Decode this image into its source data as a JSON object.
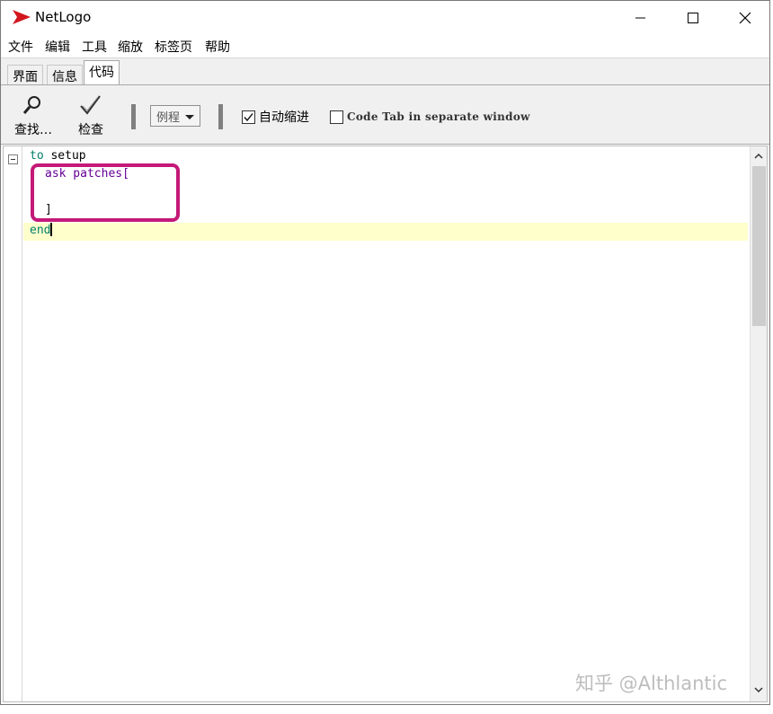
{
  "window": {
    "title": "NetLogo"
  },
  "menu": {
    "items": [
      "文件",
      "编辑",
      "工具",
      "缩放",
      "标签页",
      "帮助"
    ]
  },
  "tabs": {
    "items": [
      "界面",
      "信息",
      "代码"
    ],
    "active": "代码"
  },
  "toolbar": {
    "find_label": "查找…",
    "check_label": "检查",
    "procedures_label": "例程",
    "auto_indent_label": "自动缩进",
    "auto_indent_checked": true,
    "separate_window_label": "Code Tab in separate window",
    "separate_window_checked": false
  },
  "editor": {
    "lines": [
      {
        "kw": "to",
        "rest": " setup"
      },
      {
        "kw": "ask",
        "rest": " patches["
      },
      {
        "kw": "",
        "rest": ""
      },
      {
        "kw": "",
        "rest": "]"
      },
      {
        "kw": "end",
        "rest": ""
      }
    ]
  },
  "colors": {
    "keyword_green": "#007f69",
    "keyword_purple": "#660096",
    "annotation_box": "#c41978",
    "current_line": "#ffffcc",
    "app_icon_red": "#d1171d"
  },
  "watermark": "知乎 @Althlantic"
}
